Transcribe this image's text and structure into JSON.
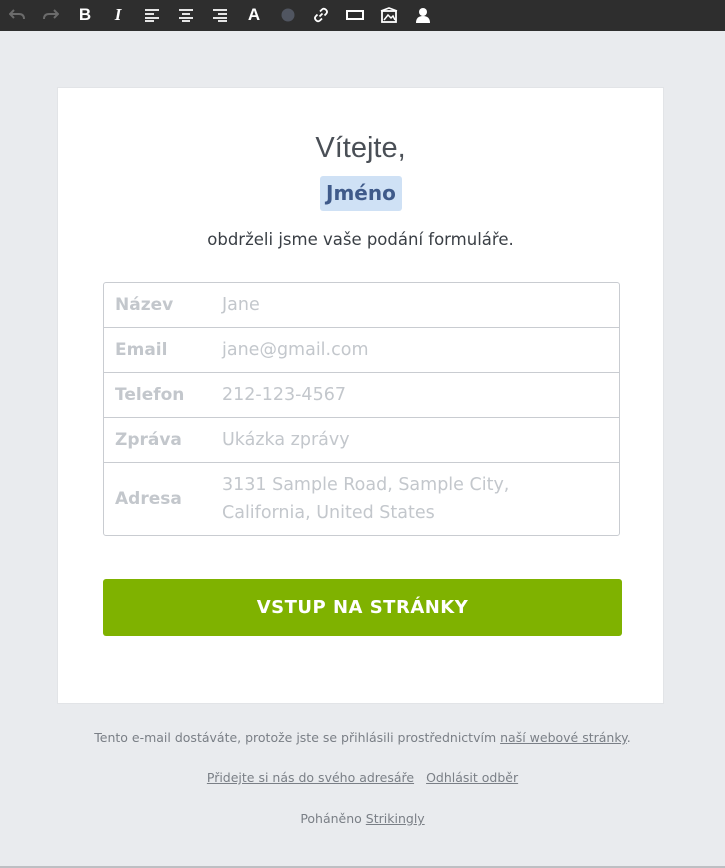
{
  "toolbar": {
    "buttons": [
      {
        "name": "undo-icon",
        "glyph": "↶"
      },
      {
        "name": "redo-icon",
        "glyph": "↷"
      },
      {
        "name": "bold-icon",
        "glyph": "B"
      },
      {
        "name": "italic-icon",
        "glyph": "I"
      },
      {
        "name": "align-left-icon"
      },
      {
        "name": "align-center-icon"
      },
      {
        "name": "align-right-icon"
      },
      {
        "name": "font-icon",
        "glyph": "A"
      },
      {
        "name": "color-dot-icon"
      },
      {
        "name": "link-icon"
      },
      {
        "name": "button-icon"
      },
      {
        "name": "image-icon"
      },
      {
        "name": "user-icon"
      }
    ]
  },
  "email": {
    "greeting": "Vítejte,",
    "name_tag": "Jméno",
    "subtitle": "obdrželi jsme vaše podání formuláře.",
    "fields": [
      {
        "label": "Název",
        "value": "Jane"
      },
      {
        "label": "Email",
        "value": "jane@gmail.com"
      },
      {
        "label": "Telefon",
        "value": "212-123-4567"
      },
      {
        "label": "Zpráva",
        "value": "Ukázka zprávy"
      },
      {
        "label": "Adresa",
        "value": "3131 Sample Road, Sample City, California, United States"
      }
    ],
    "cta_label": "VSTUP NA STRÁNKY"
  },
  "footer": {
    "notice_prefix": "Tento e-mail dostáváte, protože jste se přihlásili prostřednictvím ",
    "notice_link": "naší webové stránky",
    "notice_suffix": ".",
    "add_address_link": "Přidejte si nás do svého adresáře",
    "unsubscribe_link": "Odhlásit odběr",
    "powered_prefix": "Poháněno ",
    "powered_link": "Strikingly"
  },
  "colors": {
    "toolbar_bg": "#2e2e2e",
    "page_bg": "#e9ebee",
    "cta_bg": "#7fb200",
    "name_chip_bg": "#cfe1f5"
  }
}
